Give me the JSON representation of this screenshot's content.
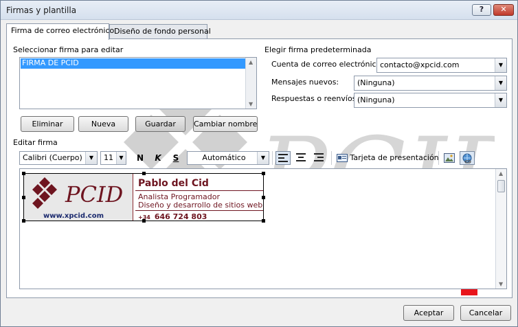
{
  "window": {
    "title": "Firmas y plantilla",
    "help_label": "?",
    "close_label": "✕"
  },
  "tabs": [
    {
      "label": "Firma de correo electrónico"
    },
    {
      "label": "Diseño de fondo personal"
    }
  ],
  "select_signature": {
    "heading": "Seleccionar firma para editar",
    "items": [
      "FIRMA DE PCID"
    ],
    "buttons": {
      "delete": "Eliminar",
      "new": "Nueva",
      "save": "Guardar",
      "rename": "Cambiar nombre"
    }
  },
  "default_signature": {
    "heading": "Elegir firma predeterminada",
    "account_label": "Cuenta de correo electrónico:",
    "account_value": "contacto@xpcid.com",
    "new_messages_label": "Mensajes nuevos:",
    "new_messages_value": "(Ninguna)",
    "replies_label": "Respuestas o reenvíos:",
    "replies_value": "(Ninguna)"
  },
  "edit_signature": {
    "heading": "Editar firma",
    "font": "Calibri (Cuerpo)",
    "size": "11",
    "bold": "N",
    "italic": "K",
    "underline": "S",
    "color": "Automático",
    "business_card": "Tarjeta de presentación"
  },
  "signature": {
    "logo": "PCID",
    "name": "Pablo del Cid",
    "role": "Analista Programador",
    "description": "Diseño y desarrollo de sitios web",
    "phone_prefix": "+34",
    "phone": "646 724 803",
    "website": "www.xpcid.com"
  },
  "watermark": "PCID",
  "footer": {
    "ok": "Aceptar",
    "cancel": "Cancelar"
  },
  "colors": {
    "accent_red": "#e8141b",
    "brand": "#6e1520"
  }
}
